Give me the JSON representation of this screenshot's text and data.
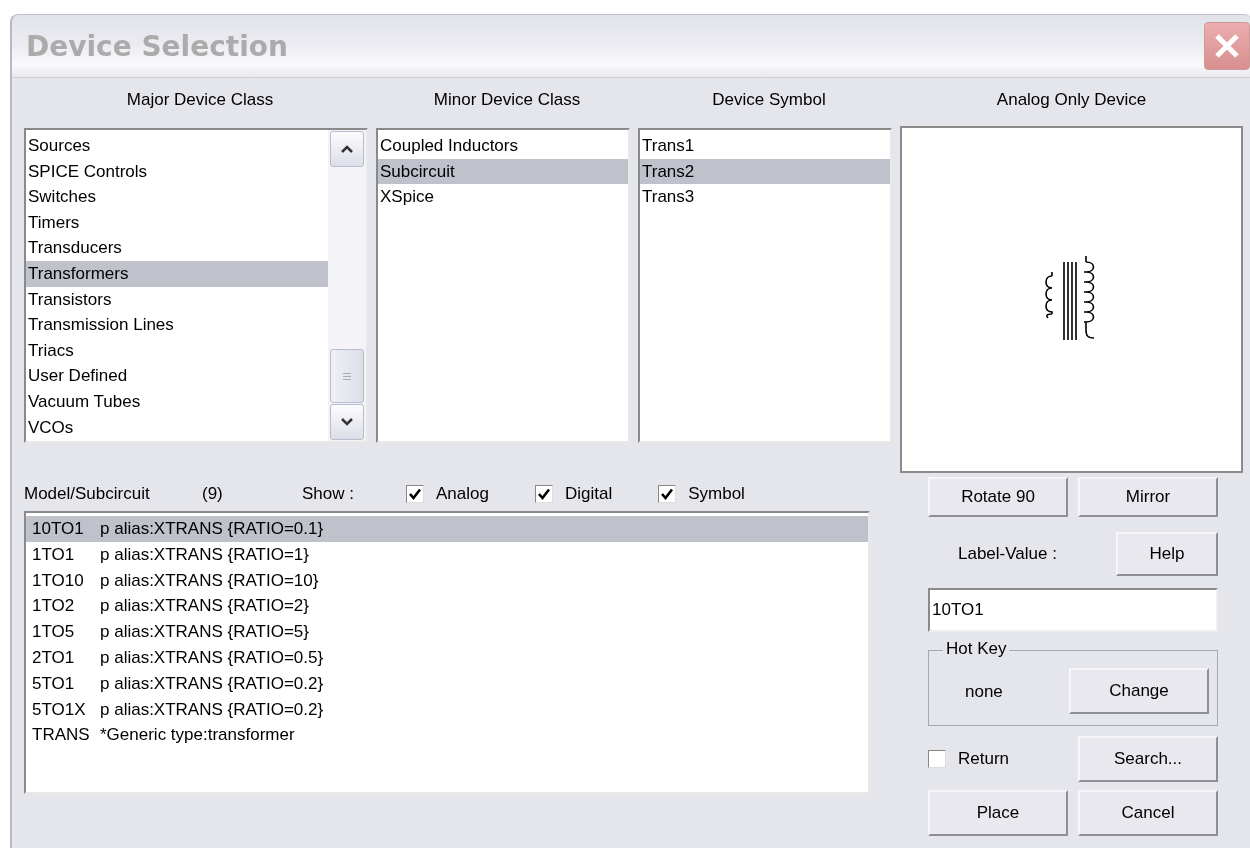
{
  "window": {
    "title": "Device Selection"
  },
  "major_device_class": {
    "heading": "Major Device Class",
    "items": [
      {
        "label": "Sources",
        "selected": false
      },
      {
        "label": "SPICE Controls",
        "selected": false
      },
      {
        "label": "Switches",
        "selected": false
      },
      {
        "label": "Timers",
        "selected": false
      },
      {
        "label": "Transducers",
        "selected": false
      },
      {
        "label": "Transformers",
        "selected": true
      },
      {
        "label": "Transistors",
        "selected": false
      },
      {
        "label": "Transmission Lines",
        "selected": false
      },
      {
        "label": "Triacs",
        "selected": false
      },
      {
        "label": "User Defined",
        "selected": false
      },
      {
        "label": "Vacuum Tubes",
        "selected": false
      },
      {
        "label": "VCOs",
        "selected": false
      }
    ]
  },
  "minor_device_class": {
    "heading": "Minor Device Class",
    "items": [
      {
        "label": "Coupled Inductors",
        "selected": false
      },
      {
        "label": "Subcircuit",
        "selected": true
      },
      {
        "label": "XSpice",
        "selected": false
      }
    ]
  },
  "device_symbol": {
    "heading": "Device Symbol",
    "items": [
      {
        "label": "Trans1",
        "selected": false
      },
      {
        "label": "Trans2",
        "selected": true
      },
      {
        "label": "Trans3",
        "selected": false
      }
    ]
  },
  "preview": {
    "heading": "Analog Only Device"
  },
  "models": {
    "label": "Model/Subcircuit",
    "count": "(9)",
    "show_label": "Show :",
    "filters": [
      {
        "label": "Analog",
        "checked": true
      },
      {
        "label": "Digital",
        "checked": true
      },
      {
        "label": "Symbol",
        "checked": true
      }
    ],
    "rows": [
      {
        "name": "10TO1",
        "description": "p alias:XTRANS {RATIO=0.1}",
        "selected": true
      },
      {
        "name": "1TO1",
        "description": "p alias:XTRANS {RATIO=1}",
        "selected": false
      },
      {
        "name": "1TO10",
        "description": "p alias:XTRANS {RATIO=10}",
        "selected": false
      },
      {
        "name": "1TO2",
        "description": "p alias:XTRANS {RATIO=2}",
        "selected": false
      },
      {
        "name": "1TO5",
        "description": "p alias:XTRANS {RATIO=5}",
        "selected": false
      },
      {
        "name": "2TO1",
        "description": "p alias:XTRANS {RATIO=0.5}",
        "selected": false
      },
      {
        "name": "5TO1",
        "description": "p alias:XTRANS {RATIO=0.2}",
        "selected": false
      },
      {
        "name": "5TO1X",
        "description": "p alias:XTRANS {RATIO=0.2}",
        "selected": false
      },
      {
        "name": "TRANS",
        "description": "*Generic type:transformer",
        "selected": false
      }
    ]
  },
  "rotate_button": "Rotate 90",
  "mirror_button": "Mirror",
  "label_value": {
    "label": "Label-Value :",
    "value": "10TO1"
  },
  "help_button": "Help",
  "hot_key": {
    "title": "Hot Key",
    "value": "none",
    "button": "Change"
  },
  "return_option": {
    "label": "Return",
    "checked": false
  },
  "search_button": "Search...",
  "place_button": "Place",
  "cancel_button": "Cancel"
}
